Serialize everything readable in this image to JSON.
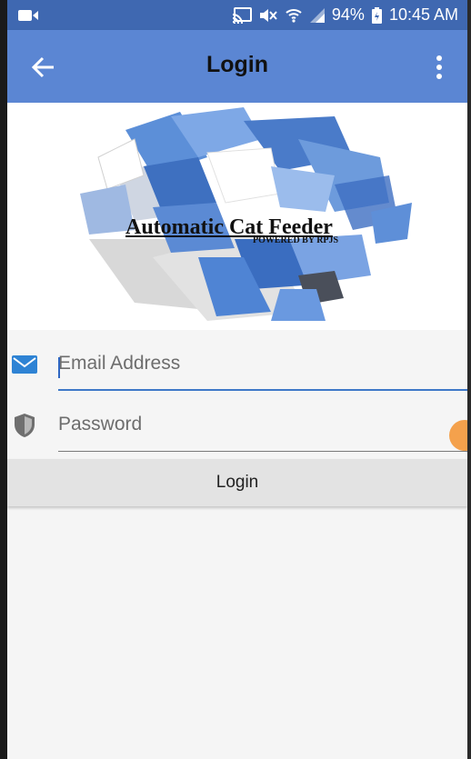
{
  "status_bar": {
    "battery": "94%",
    "time": "10:45 AM"
  },
  "app_bar": {
    "title": "Login"
  },
  "logo": {
    "title": "Automatic Cat Feeder",
    "subtitle": "POWERED BY RPJS"
  },
  "form": {
    "email_placeholder": "Email Address",
    "password_placeholder": "Password",
    "login_label": "Login"
  },
  "colors": {
    "status_bar": "#3f68b1",
    "app_bar": "#5b86d3",
    "accent": "#3f78c8",
    "button": "#e3e3e3"
  },
  "icons": [
    "screen-cast-icon",
    "mute-icon",
    "wifi-icon",
    "signal-icon",
    "battery-icon",
    "back-arrow-icon",
    "more-vert-icon",
    "mail-icon",
    "shield-icon"
  ]
}
